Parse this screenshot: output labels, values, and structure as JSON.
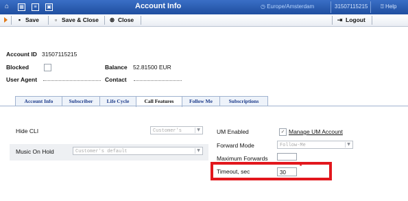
{
  "app": {
    "title": "Account Info",
    "timezone": "Europe/Amsterdam",
    "account_number": "31507115215",
    "help": "Help"
  },
  "toolbar": {
    "save": "Save",
    "save_close": "Save & Close",
    "close": "Close",
    "logout": "Logout"
  },
  "account": {
    "id_label": "Account ID",
    "id_value": "31507115215",
    "blocked_label": "Blocked",
    "blocked_checked": false,
    "balance_label": "Balance",
    "balance_value": "52.81500 EUR",
    "user_agent_label": "User Agent",
    "contact_label": "Contact"
  },
  "tabs": [
    {
      "label": "Account Info",
      "active": false
    },
    {
      "label": "Subscriber",
      "active": false
    },
    {
      "label": "Life Cycle",
      "active": false
    },
    {
      "label": "Call Features",
      "active": true
    },
    {
      "label": "Follow Me",
      "active": false
    },
    {
      "label": "Subscriptions",
      "active": false
    }
  ],
  "call_features": {
    "hide_cli_label": "Hide CLI",
    "hide_cli_value": "Customer's",
    "music_on_hold_label": "Music On Hold",
    "music_on_hold_value": "Customer's default",
    "um_enabled_label": "UM Enabled",
    "um_enabled_checked": true,
    "manage_um_link": "Manage UM Account",
    "forward_mode_label": "Forward Mode",
    "forward_mode_value": "Follow-Me",
    "max_forwards_label": "Maximum Forwards",
    "max_forwards_value": "",
    "timeout_label": "Timeout, sec",
    "timeout_value": "30",
    "required_mark": "*"
  },
  "colors": {
    "titlebar": "#2a5cb5",
    "highlight": "#e2171d",
    "tab_text": "#1b3a8a"
  }
}
